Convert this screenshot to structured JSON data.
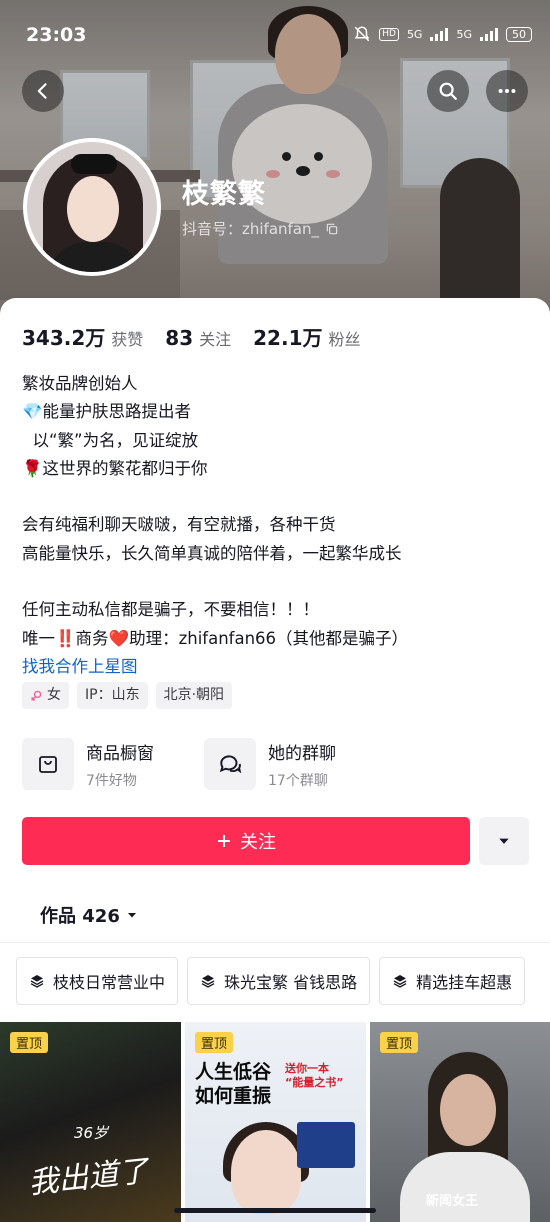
{
  "status_bar": {
    "time": "23:03",
    "hd": "HD",
    "net1": "5G",
    "net2": "5G",
    "battery": "50"
  },
  "profile": {
    "nickname": "枝繁繁",
    "douyin_id": "抖音号：zhifanfan_"
  },
  "stats": [
    {
      "value": "343.2万",
      "label": "获赞"
    },
    {
      "value": "83",
      "label": "关注"
    },
    {
      "value": "22.1万",
      "label": "粉丝"
    }
  ],
  "bio": {
    "line1": "繁妆品牌创始人",
    "line2": "💎能量护肤思路提出者",
    "line3": "  以“繁”为名，见证绽放",
    "line4": "🌹这世界的繁花都归于你",
    "line5": "",
    "line6": "会有纯福利聊天啵啵，有空就播，各种干货",
    "line7": "高能量快乐，长久简单真诚的陪伴着，一起繁华成长",
    "line8": "",
    "line9": "任何主动私信都是骗子，不要相信！！！",
    "line10": "唯一‼️商务❤️助理：zhifanfan66（其他都是骗子）",
    "link": "找我合作上星图"
  },
  "tags": {
    "gender": "女",
    "ip": "IP：山东",
    "location": "北京·朝阳"
  },
  "features": {
    "shop": {
      "title": "商品橱窗",
      "sub": "7件好物"
    },
    "group": {
      "title": "她的群聊",
      "sub": "17个群聊"
    }
  },
  "actions": {
    "follow": "关注"
  },
  "works": {
    "label": "作品 426"
  },
  "collections": [
    "枝枝日常营业中",
    "珠光宝繁 省钱思路",
    "精选挂车超惠"
  ],
  "videos": [
    {
      "pin": "置顶",
      "caption_big": "我出道了",
      "caption_small": "36岁"
    },
    {
      "pin": "置顶",
      "title": "人生低谷\n如何重振",
      "badge": "送你一本\n“能量之书”"
    },
    {
      "pin": "置顶",
      "caption": "新闻女王"
    }
  ],
  "colors": {
    "accent": "#fe2c55",
    "link": "#0f63c9",
    "pin": "#f9d24a"
  }
}
